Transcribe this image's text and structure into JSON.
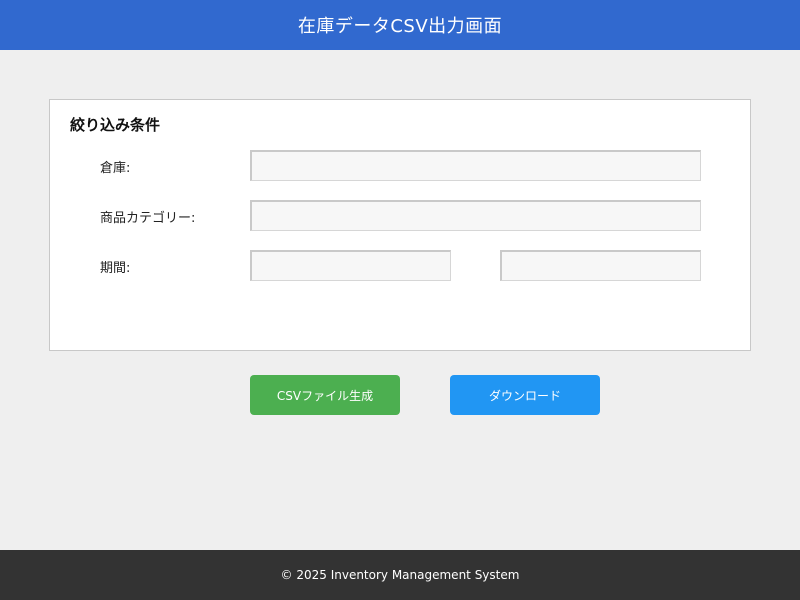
{
  "header": {
    "title": "在庫データCSV出力画面"
  },
  "filter_panel": {
    "title": "絞り込み条件",
    "warehouse": {
      "label": "倉庫:",
      "value": "",
      "placeholder": ""
    },
    "category": {
      "label": "商品カテゴリー:",
      "value": "",
      "placeholder": ""
    },
    "period": {
      "label": "期間:",
      "start": {
        "value": "",
        "placeholder": ""
      },
      "end": {
        "value": "",
        "placeholder": ""
      }
    }
  },
  "actions": {
    "generate_label": "CSVファイル生成",
    "download_label": "ダウンロード"
  },
  "footer": {
    "text": "© 2025 Inventory Management System"
  },
  "colors": {
    "header": "#3169cf",
    "generate_button": "#4caf50",
    "download_button": "#2196f3",
    "footer": "#333333",
    "background": "#efefef"
  }
}
